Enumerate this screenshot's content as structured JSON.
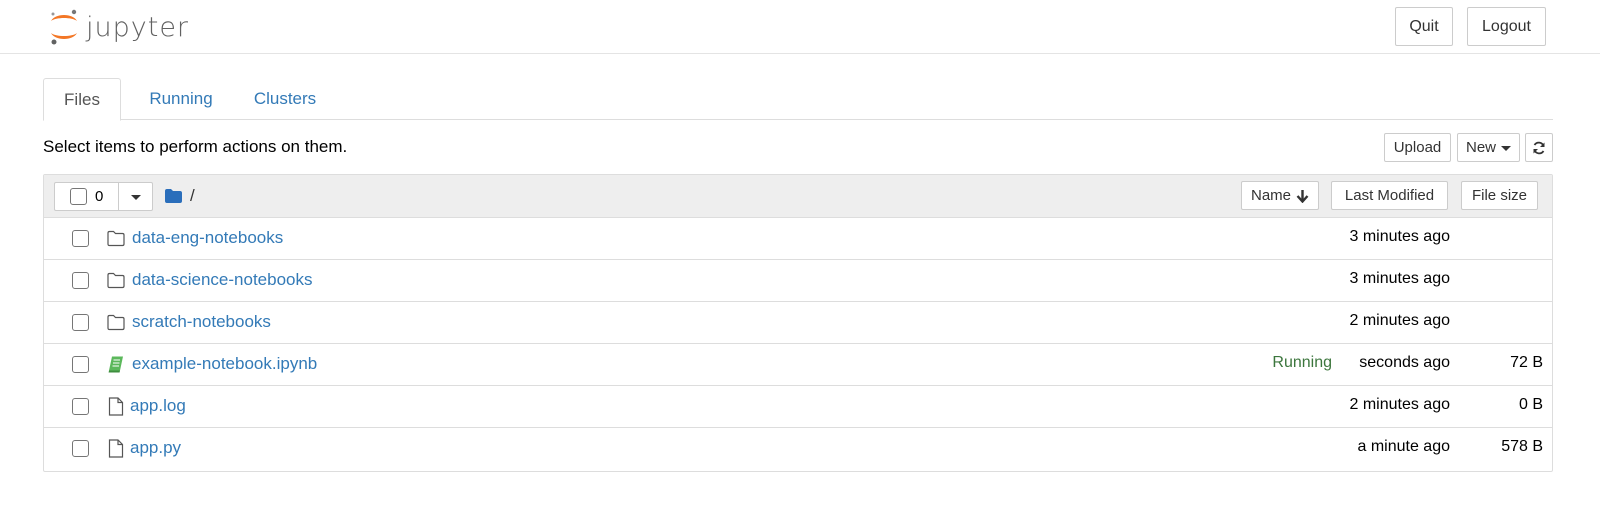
{
  "header": {
    "logo_text": "jupyter",
    "quit_label": "Quit",
    "logout_label": "Logout"
  },
  "tabs": [
    {
      "label": "Files",
      "active": true
    },
    {
      "label": "Running",
      "active": false
    },
    {
      "label": "Clusters",
      "active": false
    }
  ],
  "toolbar": {
    "hint": "Select items to perform actions on them.",
    "upload_label": "Upload",
    "new_label": "New",
    "refresh_icon": "refresh-icon"
  },
  "list_header": {
    "selected_count": "0",
    "breadcrumb": "/",
    "sort_name_label": "Name",
    "sort_modified_label": "Last Modified",
    "sort_size_label": "File size"
  },
  "files": [
    {
      "name": "data-eng-notebooks",
      "type": "folder",
      "status": "",
      "modified": "3 minutes ago",
      "size": ""
    },
    {
      "name": "data-science-notebooks",
      "type": "folder",
      "status": "",
      "modified": "3 minutes ago",
      "size": ""
    },
    {
      "name": "scratch-notebooks",
      "type": "folder",
      "status": "",
      "modified": "2 minutes ago",
      "size": ""
    },
    {
      "name": "example-notebook.ipynb",
      "type": "notebook",
      "status": "Running",
      "modified": "seconds ago",
      "size": "72 B"
    },
    {
      "name": "app.log",
      "type": "file",
      "status": "",
      "modified": "2 minutes ago",
      "size": "0 B"
    },
    {
      "name": "app.py",
      "type": "file",
      "status": "",
      "modified": "a minute ago",
      "size": "578 B"
    }
  ],
  "colors": {
    "link": "#337ab7",
    "running": "#3c763d",
    "jupyter_orange": "#f37726",
    "folder_blue": "#2a6ebb",
    "notebook_green": "#5cb85c"
  }
}
